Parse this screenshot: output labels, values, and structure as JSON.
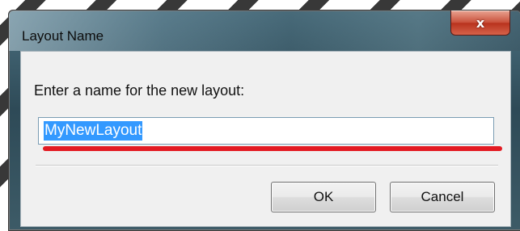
{
  "dialog": {
    "title": "Layout Name",
    "close_glyph": "x",
    "prompt": "Enter a name for the new layout:",
    "input_value": "MyNewLayout",
    "ok_label": "OK",
    "cancel_label": "Cancel"
  },
  "colors": {
    "selection": "#3399ff",
    "annotation_underline": "#e31b23",
    "close_button": "#c9503a"
  }
}
